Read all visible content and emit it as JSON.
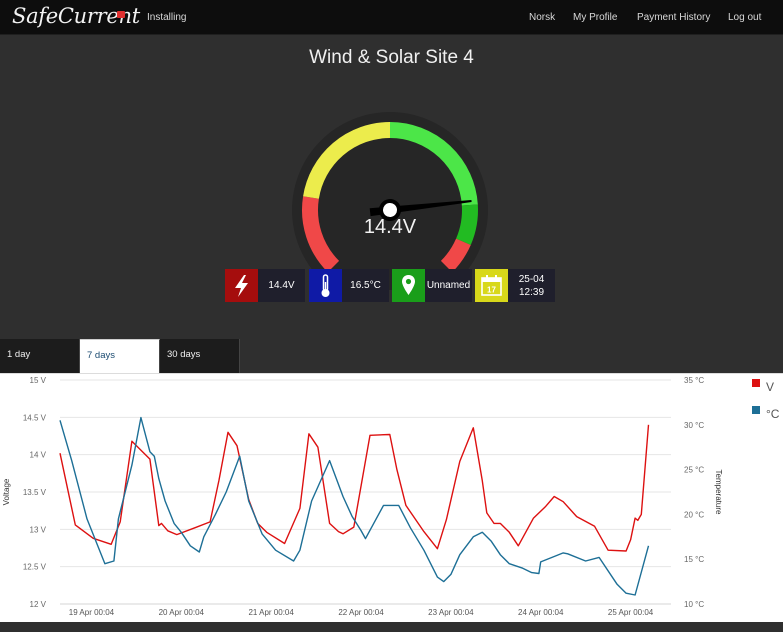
{
  "app": {
    "brand": "SafeCurrent",
    "section_link": "Installing"
  },
  "nav": {
    "language": "Norsk",
    "profile": "My Profile",
    "payments": "Payment History",
    "logout": "Log out"
  },
  "site": {
    "title": "Wind & Solar Site 4"
  },
  "gauge": {
    "reading_label": "14.4V",
    "value": 14.4,
    "needle_fraction": 0.81,
    "zone_colors": {
      "low": "#f04848",
      "mid": "#ecec4c",
      "high": "#4ce648",
      "high_dark": "#22bb22"
    }
  },
  "stats": [
    {
      "icon": "lightning-icon",
      "color": "#a50d0d",
      "value": "14.4V"
    },
    {
      "icon": "thermometer-icon",
      "color": "#0f1aa6",
      "value": "16.5°C"
    },
    {
      "icon": "map-pin-icon",
      "color": "#1a9e1a",
      "value": "Unnamed"
    },
    {
      "icon": "calendar-icon",
      "color": "#d8d81a",
      "icon_text": "17",
      "value_line1": "25-04",
      "value_line2": "12:39"
    }
  ],
  "tabs": [
    {
      "label": "1 day",
      "active": false
    },
    {
      "label": "7 days",
      "active": true
    },
    {
      "label": "30 days",
      "active": false
    }
  ],
  "chart_data": {
    "type": "line",
    "ylabel": "Voltage",
    "y2label": "Temperature",
    "ylim": [
      12,
      15
    ],
    "y2lim": [
      10,
      35
    ],
    "yticks": [
      "12 V",
      "12.5 V",
      "13 V",
      "13.5 V",
      "14 V",
      "14.5 V",
      "15 V"
    ],
    "y2ticks": [
      "10 °C",
      "15 °C",
      "20 °C",
      "25 °C",
      "30 °C",
      "35 °C"
    ],
    "xticks": [
      "19 Apr 00:04",
      "20 Apr 00:04",
      "21 Apr 00:04",
      "22 Apr 00:04",
      "23 Apr 00:04",
      "24 Apr 00:04",
      "25 Apr 00:04"
    ],
    "xlim": [
      -0.05,
      6.75
    ],
    "grid": true,
    "legend_position": "top-right",
    "series": [
      {
        "name": "V",
        "color": "#dd1111",
        "axis": "left",
        "x": [
          -0.05,
          0.12,
          0.32,
          0.52,
          0.62,
          0.75,
          0.95,
          1.05,
          1.08,
          1.15,
          1.25,
          1.45,
          1.62,
          1.72,
          1.82,
          1.92,
          2.05,
          2.15,
          2.25,
          2.45,
          2.62,
          2.72,
          2.82,
          2.95,
          3.05,
          3.1,
          3.22,
          3.4,
          3.62,
          3.7,
          3.8,
          4.0,
          4.15,
          4.25,
          4.4,
          4.55,
          4.65,
          4.7,
          4.78,
          4.85,
          4.95,
          5.05,
          5.22,
          5.35,
          5.45,
          5.55,
          5.7,
          5.9,
          6.05,
          6.25,
          6.3,
          6.35,
          6.38,
          6.42,
          6.5
        ],
        "values": [
          14.02,
          13.06,
          12.88,
          12.8,
          13.1,
          14.18,
          13.94,
          13.05,
          13.08,
          12.98,
          12.93,
          13.02,
          13.1,
          13.66,
          14.3,
          14.12,
          13.4,
          13.08,
          12.96,
          12.81,
          13.28,
          14.28,
          14.1,
          13.08,
          12.97,
          12.94,
          13.03,
          14.26,
          14.27,
          13.8,
          13.32,
          12.97,
          12.74,
          13.13,
          13.91,
          14.36,
          13.65,
          13.22,
          13.08,
          13.08,
          12.96,
          12.78,
          13.15,
          13.3,
          13.44,
          13.37,
          13.17,
          13.04,
          12.72,
          12.71,
          12.86,
          13.15,
          13.12,
          13.2,
          14.4
        ]
      },
      {
        "name": "°C",
        "color": "#1d6f96",
        "axis": "right",
        "x": [
          -0.05,
          0.08,
          0.25,
          0.45,
          0.55,
          0.6,
          0.75,
          0.85,
          0.95,
          1.0,
          1.05,
          1.12,
          1.22,
          1.3,
          1.4,
          1.5,
          1.55,
          1.68,
          1.8,
          1.95,
          2.05,
          2.2,
          2.35,
          2.55,
          2.62,
          2.75,
          2.95,
          3.1,
          3.2,
          3.3,
          3.35,
          3.55,
          3.65,
          3.72,
          3.85,
          4.0,
          4.15,
          4.22,
          4.3,
          4.4,
          4.55,
          4.65,
          4.75,
          4.85,
          4.95,
          5.1,
          5.2,
          5.28,
          5.3,
          5.45,
          5.55,
          5.6,
          5.8,
          5.95,
          6.15,
          6.25,
          6.35,
          6.5
        ],
        "values": [
          30.5,
          26.0,
          19.5,
          14.5,
          14.8,
          19.5,
          25.5,
          30.8,
          27.0,
          26.5,
          24.0,
          21.5,
          19.0,
          18.0,
          16.5,
          15.8,
          17.5,
          20.0,
          22.5,
          26.5,
          21.5,
          17.8,
          16.0,
          14.8,
          16.0,
          21.5,
          26.0,
          22.0,
          19.8,
          18.2,
          17.3,
          21.0,
          21.0,
          21.0,
          18.5,
          16.0,
          13.0,
          12.5,
          13.3,
          15.5,
          17.5,
          18.0,
          17.0,
          15.5,
          14.5,
          14.0,
          13.5,
          13.4,
          14.7,
          15.3,
          15.7,
          15.6,
          14.8,
          15.2,
          12.2,
          11.2,
          11.0,
          16.5
        ]
      }
    ]
  }
}
